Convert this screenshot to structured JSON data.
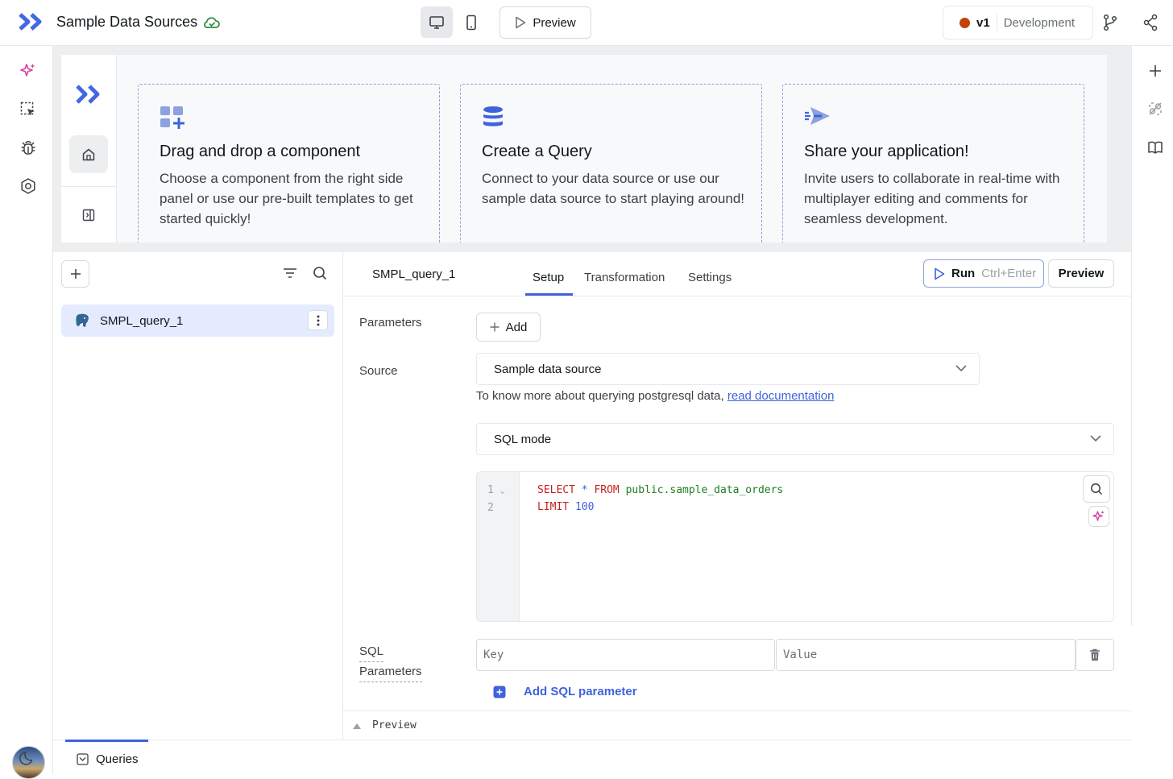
{
  "app": {
    "title": "Sample Data Sources"
  },
  "topbar": {
    "preview_label": "Preview",
    "env_version": "v1",
    "env_name": "Development",
    "env_color": "#c2410c"
  },
  "canvas": {
    "cards": [
      {
        "icon": "grid-plus-icon",
        "title": "Drag and drop a component",
        "text": "Choose a component from the right side panel or use our pre-built templates to get started quickly!"
      },
      {
        "icon": "database-icon",
        "title": "Create a Query",
        "text": "Connect to your data source or use our sample data source to start playing around!"
      },
      {
        "icon": "send-icon",
        "title": "Share your application!",
        "text": "Invite users to collaborate in real-time with multiplayer editing and comments for seamless development."
      }
    ]
  },
  "queries": {
    "items": [
      {
        "name": "SMPL_query_1",
        "icon": "postgres-elephant-icon"
      }
    ]
  },
  "editor": {
    "query_name": "SMPL_query_1",
    "tabs": [
      "Setup",
      "Transformation",
      "Settings"
    ],
    "active_tab": "Setup",
    "run_label": "Run",
    "run_shortcut": "Ctrl+Enter",
    "preview_label": "Preview",
    "parameters_label": "Parameters",
    "add_label": "Add",
    "source_label": "Source",
    "source_value": "Sample data source",
    "help_text": "To know more about querying postgresql data,",
    "help_link": "read documentation",
    "mode_value": "SQL mode",
    "line_numbers": [
      "1",
      "2"
    ],
    "code": {
      "line1": {
        "kw1": "SELECT",
        "op": "*",
        "kw2": "FROM",
        "table": "public.sample_data_orders"
      },
      "line2": {
        "kw": "LIMIT",
        "num": "100"
      }
    },
    "sql_params_label_1": "SQL",
    "sql_params_label_2": "Parameters",
    "key_placeholder": "Key",
    "value_placeholder": "Value",
    "add_param_label": "Add SQL parameter",
    "preview_bar_label": "Preview"
  },
  "bottom": {
    "tab_label": "Queries"
  },
  "colors": {
    "accent": "#3e63dd",
    "brand": "#4368e3"
  }
}
